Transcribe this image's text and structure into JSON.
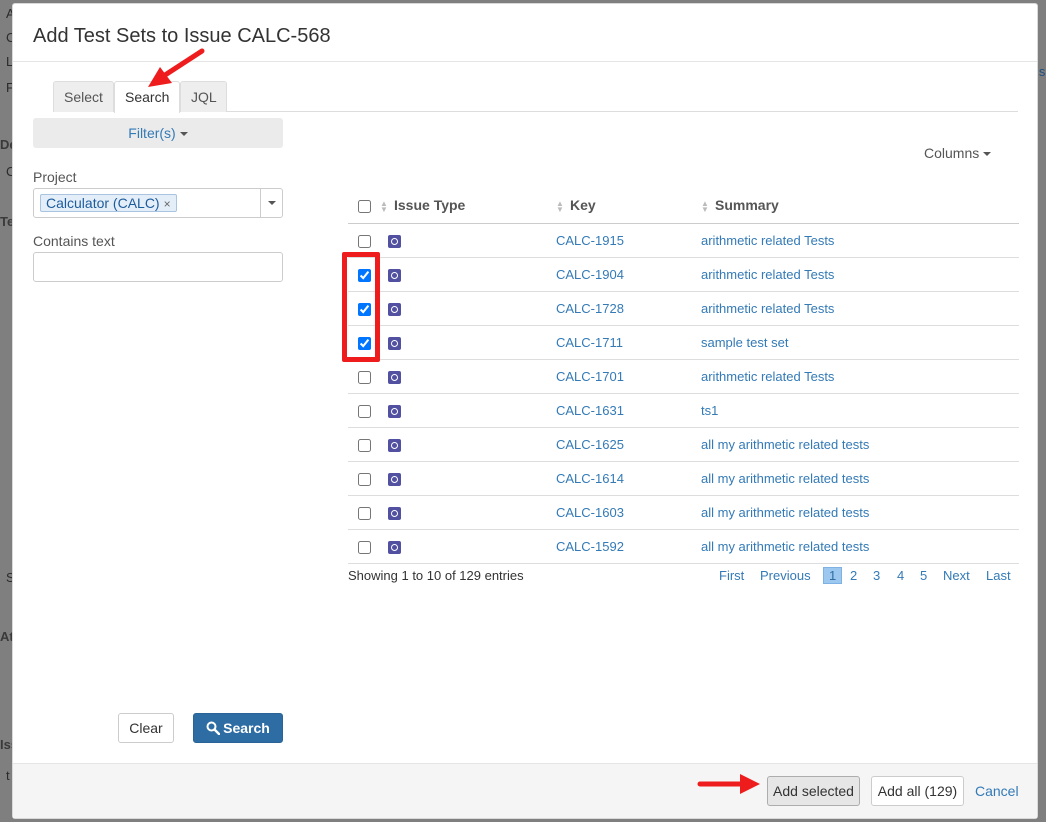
{
  "dialog": {
    "title": "Add Test Sets to Issue CALC-568"
  },
  "tabs": [
    {
      "label": "Select"
    },
    {
      "label": "Search"
    },
    {
      "label": "JQL"
    }
  ],
  "filters": {
    "button_label": "Filter(s)",
    "project_label": "Project",
    "project_value": "Calculator (CALC)",
    "contains_text_label": "Contains text",
    "contains_text_value": ""
  },
  "actions": {
    "clear_label": "Clear",
    "search_label": "Search"
  },
  "columns_label": "Columns",
  "table": {
    "headers": [
      "Issue Type",
      "Key",
      "Summary"
    ],
    "rows": [
      {
        "checked": false,
        "key": "CALC-1915",
        "summary": "arithmetic related Tests"
      },
      {
        "checked": true,
        "key": "CALC-1904",
        "summary": "arithmetic related Tests"
      },
      {
        "checked": true,
        "key": "CALC-1728",
        "summary": "arithmetic related Tests"
      },
      {
        "checked": true,
        "key": "CALC-1711",
        "summary": "sample test set"
      },
      {
        "checked": false,
        "key": "CALC-1701",
        "summary": "arithmetic related Tests"
      },
      {
        "checked": false,
        "key": "CALC-1631",
        "summary": "ts1"
      },
      {
        "checked": false,
        "key": "CALC-1625",
        "summary": "all my arithmetic related tests"
      },
      {
        "checked": false,
        "key": "CALC-1614",
        "summary": "all my arithmetic related tests"
      },
      {
        "checked": false,
        "key": "CALC-1603",
        "summary": "all my arithmetic related tests"
      },
      {
        "checked": false,
        "key": "CALC-1592",
        "summary": "all my arithmetic related tests"
      }
    ]
  },
  "pagination": {
    "info": "Showing 1 to 10 of 129 entries",
    "first": "First",
    "previous": "Previous",
    "pages": [
      "1",
      "2",
      "3",
      "4",
      "5"
    ],
    "current": "1",
    "next": "Next",
    "last": "Last"
  },
  "footer": {
    "add_selected": "Add selected",
    "add_all": "Add all (129)",
    "cancel": "Cancel"
  },
  "background": {
    "fragments": [
      "A",
      "C",
      "L",
      "F",
      "De",
      "C",
      "Te",
      "S",
      "At",
      "Iss",
      "t"
    ],
    "right_link": "is"
  },
  "colors": {
    "link": "#337ab7",
    "primary_button": "#2e6da4",
    "issue_type_icon": "#5150a1",
    "annotation": "#ee1c1c"
  },
  "icons": {
    "issue_type": "test-set-icon",
    "search_button": "search-icon",
    "sort": "sort-icon"
  }
}
